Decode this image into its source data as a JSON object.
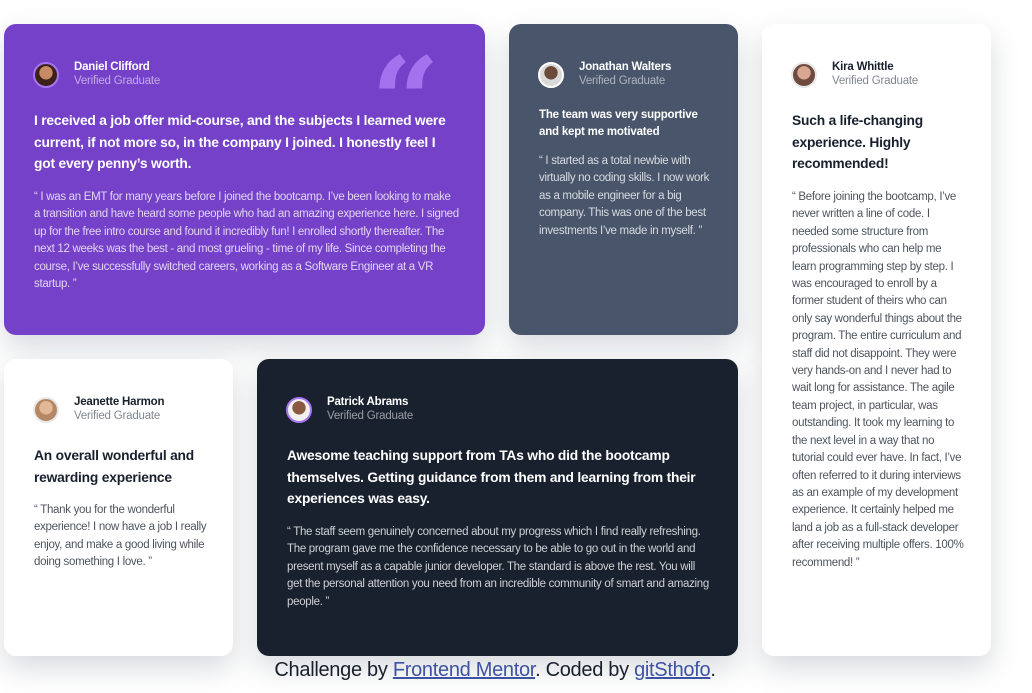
{
  "testimonials": [
    {
      "name": "Daniel Clifford",
      "role": "Verified Graduate",
      "headline": "I received a job offer mid-course, and the subjects I learned were current, if not more so, in the company I joined. I honestly feel I got every penny’s worth.",
      "text": "“ I was an EMT for many years before I joined the bootcamp. I’ve been looking to make a transition and have heard some people who had an amazing experience here. I signed up for the free intro course and found it incredibly fun! I enrolled shortly thereafter. The next 12 weeks was the best - and most grueling - time of my life. Since completing the course, I’ve successfully switched careers, working as a Software Engineer at a VR startup. ”"
    },
    {
      "name": "Jonathan Walters",
      "role": "Verified Graduate",
      "headline": "The team was very supportive and kept me motivated",
      "text": "“ I started as a total newbie with virtually no coding skills. I now work as a mobile engineer for a big company. This was one of the best investments I’ve made in myself. ”"
    },
    {
      "name": "Kira Whittle",
      "role": "Verified Graduate",
      "headline": "Such a life-changing experience. Highly recommended!",
      "text": "“ Before joining the bootcamp, I’ve never written a line of code. I needed some structure from professionals who can help me learn programming step by step. I was encouraged to enroll by a former student of theirs who can only say wonderful things about the program. The entire curriculum and staff did not disappoint. They were very hands-on and I never had to wait long for assistance. The agile team project, in particular, was outstanding. It took my learning to the next level in a way that no tutorial could ever have. In fact, I’ve often referred to it during interviews as an example of my development experience. It certainly helped me land a job as a full-stack developer after receiving multiple offers. 100% recommend! ”"
    },
    {
      "name": "Jeanette Harmon",
      "role": "Verified Graduate",
      "headline": "An overall wonderful and rewarding experience",
      "text": "“ Thank you for the wonderful experience! I now have a job I really enjoy, and make a good living while doing something I love. ”"
    },
    {
      "name": "Patrick Abrams",
      "role": "Verified Graduate",
      "headline": "Awesome teaching support from TAs who did the bootcamp themselves. Getting guidance from them and learning from their experiences was easy.",
      "text": "“ The staff seem genuinely concerned about my progress which I find really refreshing. The program gave me the confidence necessary to be able to go out in the world and present myself as a capable junior developer. The standard is above the rest. You will get the personal attention you need from an incredible community of smart and amazing people. ”"
    }
  ],
  "decoration": {
    "quote_glyph": "“"
  },
  "footer": {
    "prefix": "Challenge by ",
    "link1": "Frontend Mentor",
    "middle": ". Coded by ",
    "link2": "gitSthofo",
    "suffix": "."
  },
  "colors": {
    "violet": "#7541c8",
    "grayish_blue": "#48556a",
    "blackish_blue": "#19212e",
    "white": "#ffffff",
    "quote_accent": "#a775f1",
    "link": "#3e52a3"
  }
}
